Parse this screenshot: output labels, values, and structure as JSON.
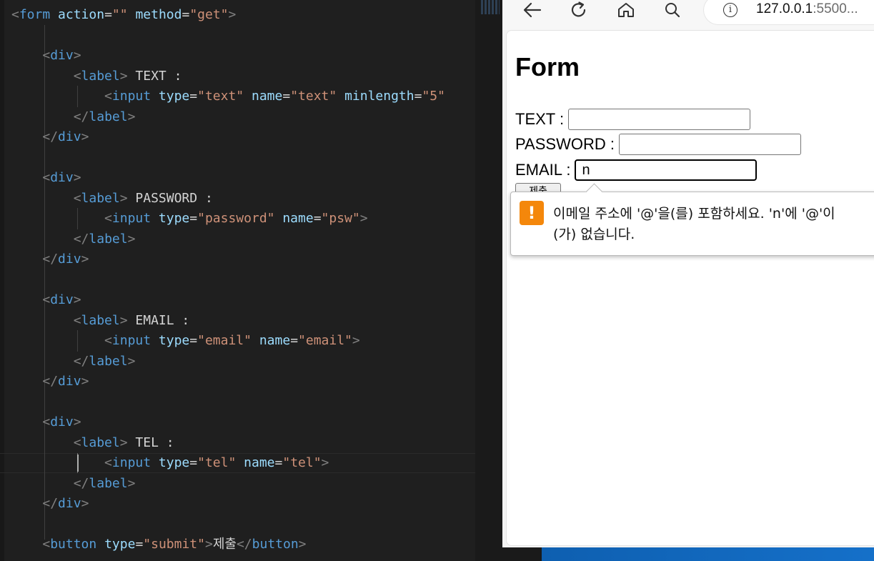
{
  "editor": {
    "lines": [
      [
        [
          "<",
          "t-bracket"
        ],
        [
          "form",
          "t-tag"
        ],
        [
          " ",
          ""
        ],
        [
          "action",
          "t-attr"
        ],
        [
          "=",
          "t-eq"
        ],
        [
          "\"\"",
          "t-str"
        ],
        [
          " ",
          ""
        ],
        [
          "method",
          "t-attr"
        ],
        [
          "=",
          "t-eq"
        ],
        [
          "\"get\"",
          "t-str"
        ],
        [
          ">",
          "t-bracket"
        ]
      ],
      [],
      [
        [
          "    ",
          ""
        ],
        [
          "<",
          "t-bracket"
        ],
        [
          "div",
          "t-tag"
        ],
        [
          ">",
          "t-bracket"
        ]
      ],
      [
        [
          "        ",
          ""
        ],
        [
          "<",
          "t-bracket"
        ],
        [
          "label",
          "t-tag"
        ],
        [
          ">",
          "t-bracket"
        ],
        [
          " TEXT :",
          "t-text"
        ]
      ],
      [
        [
          "            ",
          ""
        ],
        [
          "<",
          "t-bracket"
        ],
        [
          "input",
          "t-tag"
        ],
        [
          " ",
          ""
        ],
        [
          "type",
          "t-attr"
        ],
        [
          "=",
          "t-eq"
        ],
        [
          "\"text\"",
          "t-str"
        ],
        [
          " ",
          ""
        ],
        [
          "name",
          "t-attr"
        ],
        [
          "=",
          "t-eq"
        ],
        [
          "\"text\"",
          "t-str"
        ],
        [
          " ",
          ""
        ],
        [
          "minlength",
          "t-attr"
        ],
        [
          "=",
          "t-eq"
        ],
        [
          "\"5\"",
          "t-str"
        ]
      ],
      [
        [
          "        ",
          ""
        ],
        [
          "</",
          "t-bracket"
        ],
        [
          "label",
          "t-tag"
        ],
        [
          ">",
          "t-bracket"
        ]
      ],
      [
        [
          "    ",
          ""
        ],
        [
          "</",
          "t-bracket"
        ],
        [
          "div",
          "t-tag"
        ],
        [
          ">",
          "t-bracket"
        ]
      ],
      [],
      [
        [
          "    ",
          ""
        ],
        [
          "<",
          "t-bracket"
        ],
        [
          "div",
          "t-tag"
        ],
        [
          ">",
          "t-bracket"
        ]
      ],
      [
        [
          "        ",
          ""
        ],
        [
          "<",
          "t-bracket"
        ],
        [
          "label",
          "t-tag"
        ],
        [
          ">",
          "t-bracket"
        ],
        [
          " PASSWORD :",
          "t-text"
        ]
      ],
      [
        [
          "            ",
          ""
        ],
        [
          "<",
          "t-bracket"
        ],
        [
          "input",
          "t-tag"
        ],
        [
          " ",
          ""
        ],
        [
          "type",
          "t-attr"
        ],
        [
          "=",
          "t-eq"
        ],
        [
          "\"password\"",
          "t-str"
        ],
        [
          " ",
          ""
        ],
        [
          "name",
          "t-attr"
        ],
        [
          "=",
          "t-eq"
        ],
        [
          "\"psw\"",
          "t-str"
        ],
        [
          ">",
          "t-bracket"
        ]
      ],
      [
        [
          "        ",
          ""
        ],
        [
          "</",
          "t-bracket"
        ],
        [
          "label",
          "t-tag"
        ],
        [
          ">",
          "t-bracket"
        ]
      ],
      [
        [
          "    ",
          ""
        ],
        [
          "</",
          "t-bracket"
        ],
        [
          "div",
          "t-tag"
        ],
        [
          ">",
          "t-bracket"
        ]
      ],
      [],
      [
        [
          "    ",
          ""
        ],
        [
          "<",
          "t-bracket"
        ],
        [
          "div",
          "t-tag"
        ],
        [
          ">",
          "t-bracket"
        ]
      ],
      [
        [
          "        ",
          ""
        ],
        [
          "<",
          "t-bracket"
        ],
        [
          "label",
          "t-tag"
        ],
        [
          ">",
          "t-bracket"
        ],
        [
          " EMAIL :",
          "t-text"
        ]
      ],
      [
        [
          "            ",
          ""
        ],
        [
          "<",
          "t-bracket"
        ],
        [
          "input",
          "t-tag"
        ],
        [
          " ",
          ""
        ],
        [
          "type",
          "t-attr"
        ],
        [
          "=",
          "t-eq"
        ],
        [
          "\"email\"",
          "t-str"
        ],
        [
          " ",
          ""
        ],
        [
          "name",
          "t-attr"
        ],
        [
          "=",
          "t-eq"
        ],
        [
          "\"email\"",
          "t-str"
        ],
        [
          ">",
          "t-bracket"
        ]
      ],
      [
        [
          "        ",
          ""
        ],
        [
          "</",
          "t-bracket"
        ],
        [
          "label",
          "t-tag"
        ],
        [
          ">",
          "t-bracket"
        ]
      ],
      [
        [
          "    ",
          ""
        ],
        [
          "</",
          "t-bracket"
        ],
        [
          "div",
          "t-tag"
        ],
        [
          ">",
          "t-bracket"
        ]
      ],
      [],
      [
        [
          "    ",
          ""
        ],
        [
          "<",
          "t-bracket"
        ],
        [
          "div",
          "t-tag"
        ],
        [
          ">",
          "t-bracket"
        ]
      ],
      [
        [
          "        ",
          ""
        ],
        [
          "<",
          "t-bracket"
        ],
        [
          "label",
          "t-tag"
        ],
        [
          ">",
          "t-bracket"
        ],
        [
          " TEL :",
          "t-text"
        ]
      ],
      [
        [
          "            ",
          ""
        ],
        [
          "<",
          "t-bracket"
        ],
        [
          "input",
          "t-tag"
        ],
        [
          " ",
          ""
        ],
        [
          "type",
          "t-attr"
        ],
        [
          "=",
          "t-eq"
        ],
        [
          "\"tel\"",
          "t-str"
        ],
        [
          " ",
          ""
        ],
        [
          "name",
          "t-attr"
        ],
        [
          "=",
          "t-eq"
        ],
        [
          "\"tel\"",
          "t-str"
        ],
        [
          ">",
          "t-bracket"
        ]
      ],
      [
        [
          "        ",
          ""
        ],
        [
          "</",
          "t-bracket"
        ],
        [
          "label",
          "t-tag"
        ],
        [
          ">",
          "t-bracket"
        ]
      ],
      [
        [
          "    ",
          ""
        ],
        [
          "</",
          "t-bracket"
        ],
        [
          "div",
          "t-tag"
        ],
        [
          ">",
          "t-bracket"
        ]
      ],
      [],
      [
        [
          "    ",
          ""
        ],
        [
          "<",
          "t-bracket"
        ],
        [
          "button",
          "t-tag"
        ],
        [
          " ",
          ""
        ],
        [
          "type",
          "t-attr"
        ],
        [
          "=",
          "t-eq"
        ],
        [
          "\"submit\"",
          "t-str"
        ],
        [
          ">",
          "t-bracket"
        ],
        [
          "제출",
          "t-text"
        ],
        [
          "</",
          "t-bracket"
        ],
        [
          "button",
          "t-tag"
        ],
        [
          ">",
          "t-bracket"
        ]
      ]
    ]
  },
  "browser": {
    "toolbar": {
      "back_icon": "arrow-left-icon",
      "reload_icon": "reload-icon",
      "home_icon": "home-icon",
      "search_icon": "search-icon",
      "site_info_icon": "info-icon"
    },
    "address": {
      "host": "127.0.0.1",
      "rest": ":5500..."
    },
    "info_glyph": "i",
    "page": {
      "title": "Form",
      "fields": {
        "text_label": "TEXT :",
        "password_label": "PASSWORD :",
        "email_label": "EMAIL :",
        "email_value": "n"
      },
      "submit_label": "제출"
    },
    "validation": {
      "icon": "warning-icon",
      "icon_glyph": "!",
      "color": "#f4870b",
      "message": "이메일 주소에 '@'을(를) 포함하세요. 'n'에 '@'이(가) 없습니다."
    }
  }
}
